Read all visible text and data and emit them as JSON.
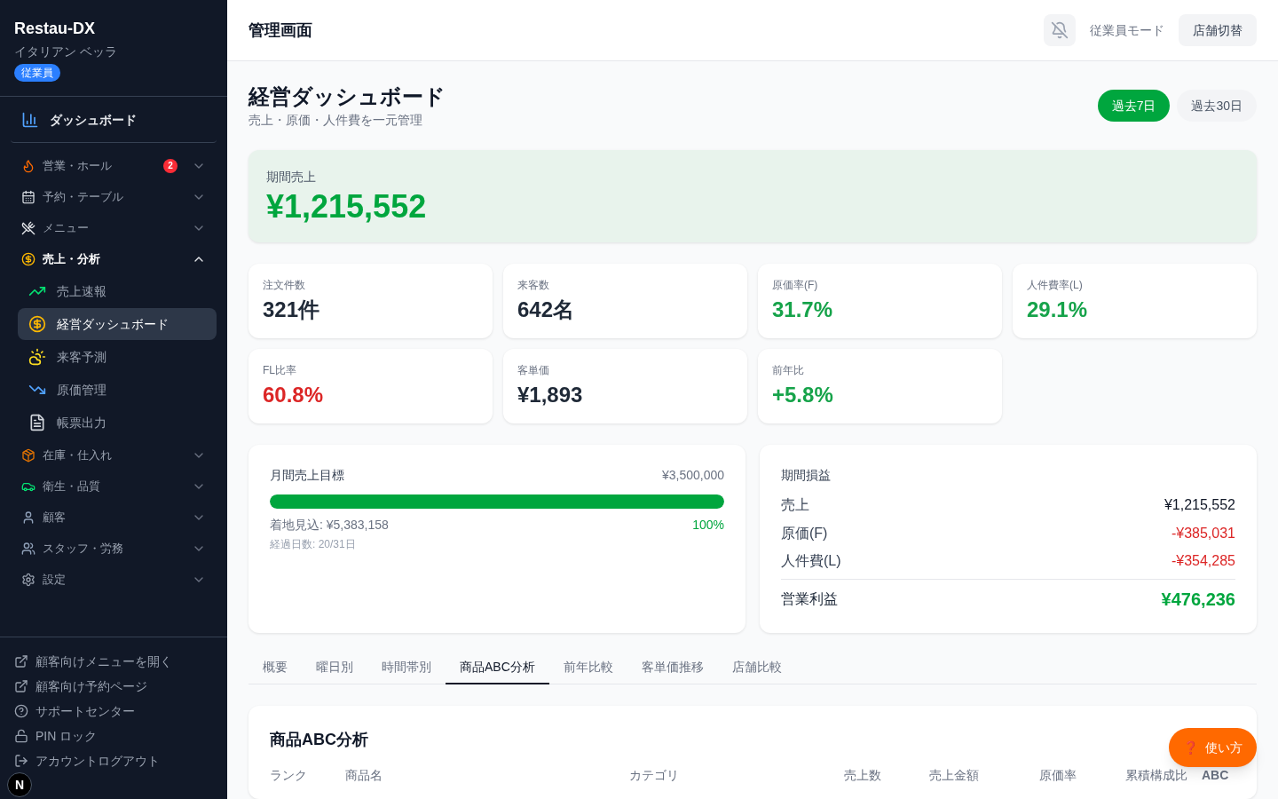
{
  "sidebar": {
    "brand": "Restau-DX",
    "store": "イタリアン ベッラ",
    "role_badge": "従業員",
    "home": {
      "label": "ダッシュボード",
      "selected": false
    },
    "groups": [
      {
        "label": "営業・ホール",
        "badge": "2",
        "expanded": false
      },
      {
        "label": "予約・テーブル",
        "expanded": false
      },
      {
        "label": "メニュー",
        "expanded": false
      },
      {
        "label": "売上・分析",
        "expanded": true,
        "children": [
          {
            "label": "売上速報",
            "selected": false
          },
          {
            "label": "経営ダッシュボード",
            "selected": true
          },
          {
            "label": "来客予測",
            "selected": false
          },
          {
            "label": "原価管理",
            "selected": false
          },
          {
            "label": "帳票出力",
            "selected": false
          }
        ]
      },
      {
        "label": "在庫・仕入れ",
        "expanded": false
      },
      {
        "label": "衛生・品質",
        "expanded": false
      },
      {
        "label": "顧客",
        "expanded": false
      },
      {
        "label": "スタッフ・労務",
        "expanded": false
      },
      {
        "label": "設定",
        "expanded": false
      }
    ],
    "footer_links": [
      {
        "kind": "external",
        "label": "顧客向けメニューを開く"
      },
      {
        "kind": "external",
        "label": "顧客向け予約ページ"
      },
      {
        "kind": "help",
        "label": "サポートセンター"
      },
      {
        "kind": "lock",
        "label": "PIN ロック"
      },
      {
        "kind": "logout",
        "label": "アカウントログアウト"
      }
    ],
    "dev_badge": "N"
  },
  "header": {
    "title": "管理画面",
    "mode_label": "従業員モード",
    "switch_button": "店舗切替"
  },
  "page": {
    "title": "経営ダッシュボード",
    "subtitle": "売上・原価・人件費を一元管理",
    "periods": [
      {
        "label": "過去7日",
        "selected": true
      },
      {
        "label": "過去30日",
        "selected": false
      }
    ]
  },
  "sales_hero": {
    "label": "期間売上",
    "value": "¥1,215,552"
  },
  "kpis": [
    {
      "label": "注文件数",
      "value": "321件",
      "color": "#1f2937"
    },
    {
      "label": "来客数",
      "value": "642名",
      "color": "#1f2937"
    },
    {
      "label": "原価率(F)",
      "value": "31.7%",
      "color": "#16a34a"
    },
    {
      "label": "人件費率(L)",
      "value": "29.1%",
      "color": "#16a34a"
    },
    {
      "label": "FL比率",
      "value": "60.8%",
      "color": "#dc2626"
    },
    {
      "label": "客単価",
      "value": "¥1,893",
      "color": "#1f2937"
    },
    {
      "label": "前年比",
      "value": "+5.8%",
      "color": "#16a34a"
    }
  ],
  "target": {
    "title": "月間売上目標",
    "amount": "¥3,500,000",
    "level": 1,
    "forecast": "着地見込: ¥5,383,158",
    "percent": "100%",
    "elapsed": "経過日数: 20/31日"
  },
  "pnl": {
    "title": "期間損益",
    "rows": [
      {
        "label": "売上",
        "value": "¥1,215,552",
        "color": "#111827"
      },
      {
        "label": "原価(F)",
        "value": "-¥385,031",
        "color": "#dc2626"
      },
      {
        "label": "人件費(L)",
        "value": "-¥354,285",
        "color": "#dc2626"
      }
    ],
    "total": {
      "label": "営業利益",
      "value": "¥476,236"
    }
  },
  "tabs": [
    {
      "label": "概要",
      "selected": false
    },
    {
      "label": "曜日別",
      "selected": false
    },
    {
      "label": "時間帯別",
      "selected": false
    },
    {
      "label": "商品ABC分析",
      "selected": true
    },
    {
      "label": "前年比較",
      "selected": false
    },
    {
      "label": "客単価推移",
      "selected": false
    },
    {
      "label": "店舗比較",
      "selected": false
    }
  ],
  "abc": {
    "title": "商品ABC分析",
    "columns": [
      "ランク",
      "商品名",
      "カテゴリ",
      "売上数",
      "売上金額",
      "原価率",
      "累積構成比",
      "ABC"
    ]
  },
  "help_button": {
    "icon": "❓",
    "label": "使い方"
  }
}
